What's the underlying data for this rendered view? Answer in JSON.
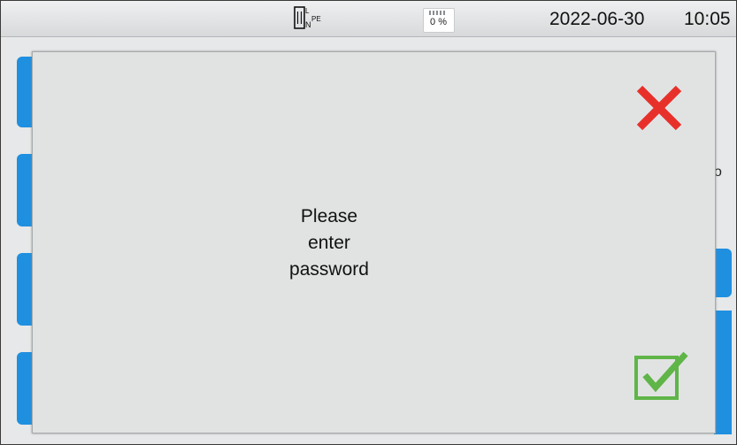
{
  "status_bar": {
    "connection_label_l": "L",
    "connection_label_n": "N",
    "connection_label_pe": "PE",
    "memory_usage": "0 %",
    "date": "2022-06-30",
    "time": "10:05"
  },
  "background": {
    "partial_text": "o"
  },
  "dialog": {
    "message_line1": "Please",
    "message_line2": "enter",
    "message_line3": "password",
    "close_icon": "red-x-icon",
    "confirm_icon": "green-checkbox-icon"
  },
  "colors": {
    "accent_blue": "#1f8fe0",
    "close_red": "#e8302a",
    "confirm_green": "#5fb548"
  }
}
